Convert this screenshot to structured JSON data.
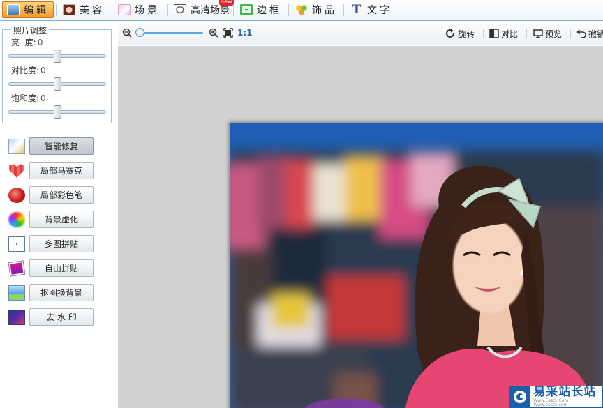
{
  "app_menu": {
    "tabs": [
      {
        "label": "编辑",
        "icon": "edit-photo-icon"
      },
      {
        "label": "美容",
        "icon": "beauty-face-icon"
      },
      {
        "label": "场景",
        "icon": "scene-icon"
      },
      {
        "label": "高清场景",
        "icon": "hd-scene-icon"
      },
      {
        "label": "边框",
        "icon": "frame-icon"
      },
      {
        "label": "饰品",
        "icon": "accessory-icon"
      },
      {
        "label": "文字",
        "icon": "text-icon"
      }
    ],
    "active_tab": "编辑",
    "badge": "new"
  },
  "adjust": {
    "title": "照片调整",
    "sliders": [
      {
        "label": "亮  度:",
        "value": "0",
        "level": 0.5
      },
      {
        "label": "对比度:",
        "value": "0",
        "level": 0.5
      },
      {
        "label": "饱和度:",
        "value": "0",
        "level": 0.5
      }
    ]
  },
  "tools": [
    {
      "label": "智能修复",
      "icon": "smart-fix-icon",
      "active": true
    },
    {
      "label": "局部马赛克",
      "icon": "mosaic-icon",
      "active": false
    },
    {
      "label": "局部彩色笔",
      "icon": "color-pen-icon",
      "active": false
    },
    {
      "label": "背景虚化",
      "icon": "blur-background-icon",
      "active": false
    },
    {
      "label": "多图拼贴",
      "icon": "multi-collage-icon",
      "active": false
    },
    {
      "label": "自由拼贴",
      "icon": "free-collage-icon",
      "active": false
    },
    {
      "label": "抠图换背景",
      "icon": "cutout-icon",
      "active": false
    },
    {
      "label": "去 水 印",
      "icon": "remove-watermark-icon",
      "active": false
    }
  ],
  "editor_toolbar": {
    "zoom_ratio": "1:1",
    "zoom_level": 0.05,
    "rotate_label": "旋转",
    "compare_label": "对比",
    "preview_label": "预览",
    "undo_label": "撤销"
  },
  "watermark": {
    "title": "易采站长站",
    "subtitle": "Www.Easck.Com  Www.easck.com"
  },
  "colors": {
    "accent": "#7fb0d8",
    "active_tab": "#f39a2c",
    "brand_blue": "#1b5fab"
  }
}
